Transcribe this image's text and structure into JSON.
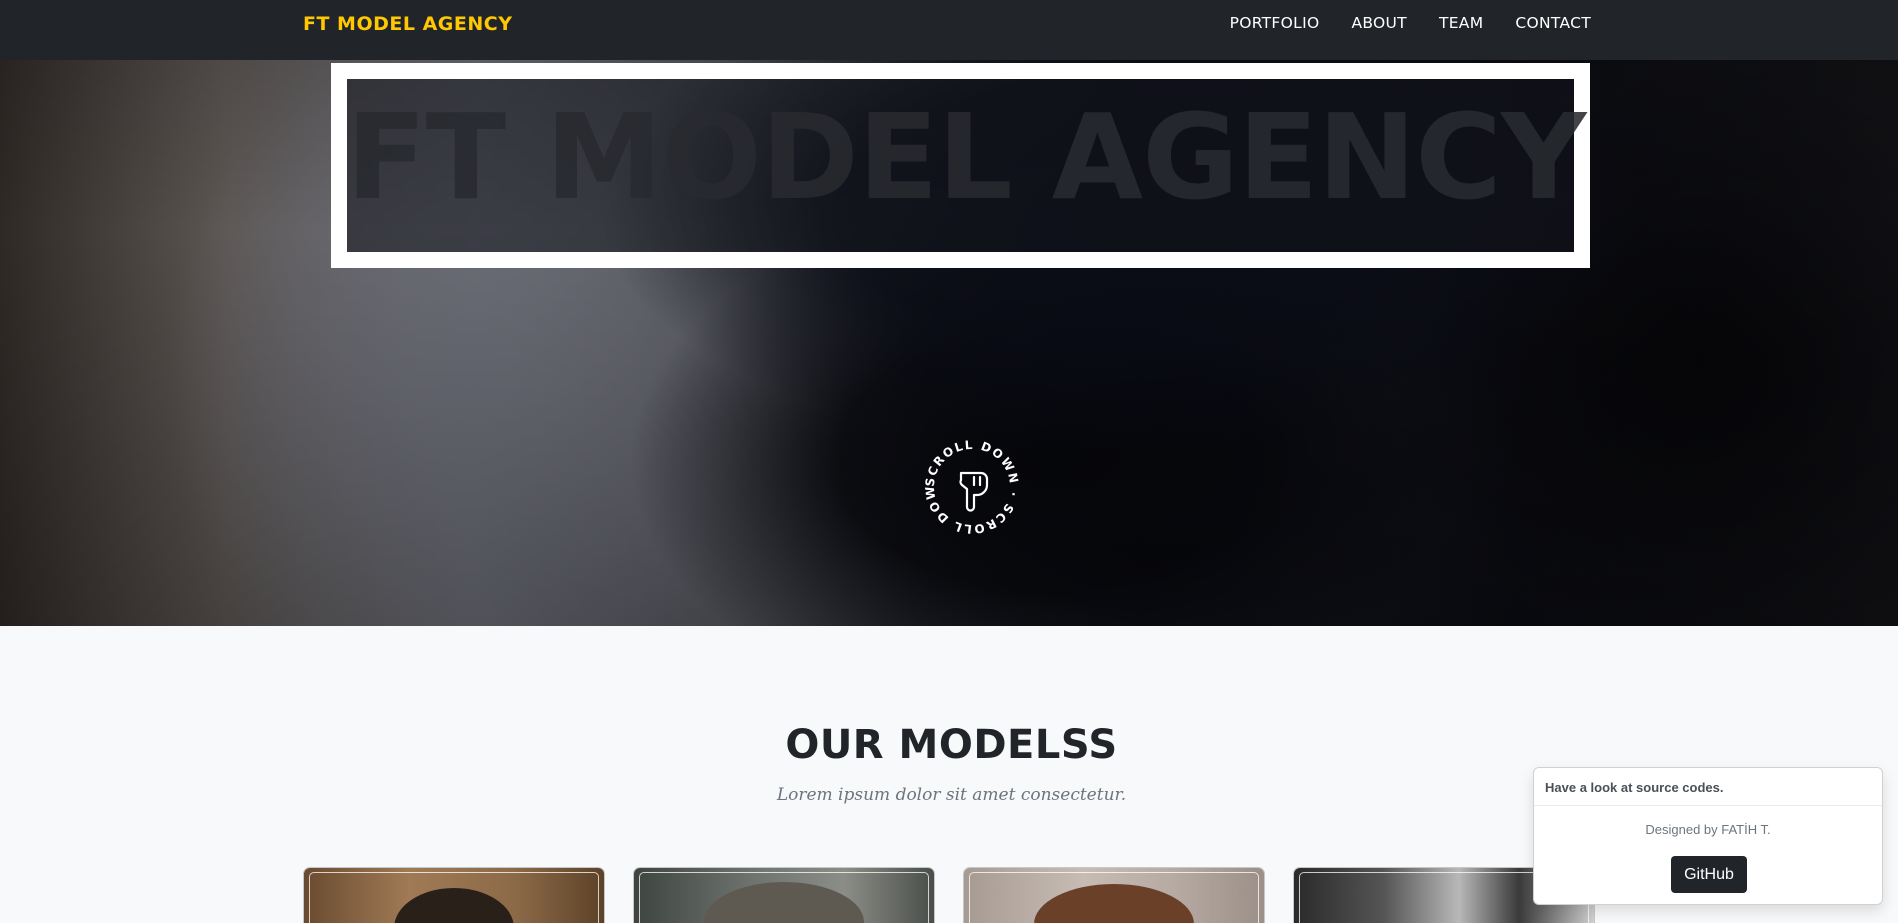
{
  "navbar": {
    "brand": "FT MODEL AGENCY",
    "links": [
      {
        "label": "PORTFOLIO"
      },
      {
        "label": "ABOUT"
      },
      {
        "label": "TEAM"
      },
      {
        "label": "CONTACT"
      }
    ],
    "brand_color": "#ffc800",
    "background": "#212529"
  },
  "hero": {
    "title": "FT MODEL AGENCY",
    "scroll_badge": {
      "ring_text": "SCROLL DOWN · SCROLL DOWN · ",
      "icon": "pointing-down-hand-icon"
    }
  },
  "models_section": {
    "heading": "OUR MODELSS",
    "subheading": "Lorem ipsum dolor sit amet consectetur.",
    "cards": [
      {
        "name": "model-card-1"
      },
      {
        "name": "model-card-2"
      },
      {
        "name": "model-card-3"
      },
      {
        "name": "model-card-4"
      }
    ]
  },
  "toast": {
    "header": "Have a look at source codes.",
    "body": "Designed by FATİH T.",
    "button_label": "GitHub"
  }
}
